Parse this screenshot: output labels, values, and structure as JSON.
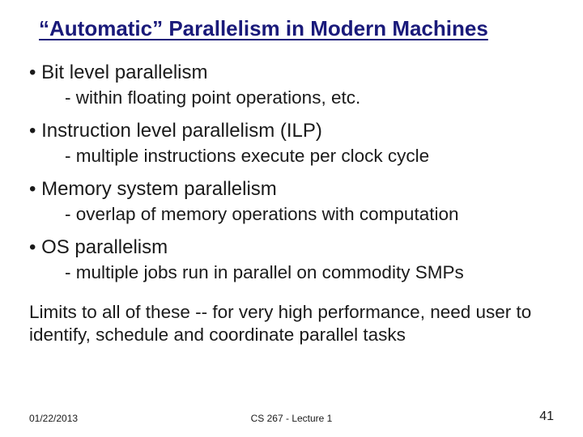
{
  "title": "“Automatic” Parallelism in Modern Machines",
  "bullets": [
    {
      "text": "Bit level parallelism",
      "sub": "within floating point operations, etc."
    },
    {
      "text": "Instruction level parallelism (ILP)",
      "sub": "multiple instructions execute per clock cycle"
    },
    {
      "text": "Memory system parallelism",
      "sub": "overlap of memory operations with computation"
    },
    {
      "text": "OS parallelism",
      "sub": "multiple jobs run in parallel on commodity SMPs"
    }
  ],
  "closing": "Limits to all of these -- for very high performance, need user to identify, schedule and coordinate parallel tasks",
  "footer": {
    "date": "01/22/2013",
    "center": "CS 267 - Lecture 1",
    "page": "41"
  }
}
